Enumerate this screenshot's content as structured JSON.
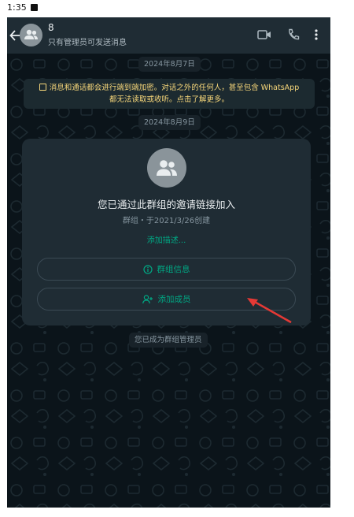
{
  "status_bar": {
    "time": "1:35"
  },
  "header": {
    "title": "8",
    "subtitle": "只有管理员可发送消息"
  },
  "chat": {
    "date_1": "2024年8月7日",
    "encryption_notice_line1": "消息和通话都会进行端到端加密。对话之外的任何人，甚至包含 WhatsApp",
    "encryption_notice_line2": "都无法读取或收听。点击了解更多。",
    "date_2": "2024年8月9日",
    "card": {
      "title": "您已通过此群组的邀请链接加入",
      "subtitle": "群组・于2021/3/26创建",
      "add_description": "添加描述...",
      "group_info_button": "群组信息",
      "add_member_button": "添加成员"
    },
    "admin_notice": "您已成为群组管理员"
  },
  "colors": {
    "accent": "#00a884",
    "header_bg": "#1f2c34",
    "chat_bg": "#0b141a",
    "annotation_arrow": "#e53935"
  },
  "icons": [
    "back-arrow-icon",
    "group-avatar-icon",
    "video-call-icon",
    "phone-call-icon",
    "more-vert-icon",
    "lock-icon",
    "info-icon",
    "add-person-icon"
  ]
}
